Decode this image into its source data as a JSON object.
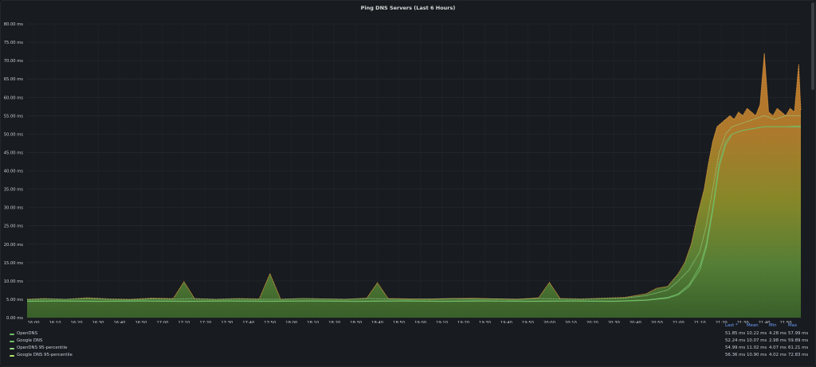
{
  "panel": {
    "title": "Ping DNS Servers (Last 6 Hours)"
  },
  "legend": {
    "headers": {
      "last": "Last *",
      "mean": "Mean",
      "min": "Min",
      "max": "Max"
    },
    "rows": [
      {
        "name": "OpenDNS",
        "color": "#73bf69",
        "last": "51.85 ms",
        "mean": "10.22 ms",
        "min": "4.28 ms",
        "max": "57.99 ms"
      },
      {
        "name": "Google DNS",
        "color": "#73bf69",
        "last": "52.24 ms",
        "mean": "10.07 ms",
        "min": "2.98 ms",
        "max": "59.89 ms"
      },
      {
        "name": "OpenDNS 95-percentile",
        "color": "#96d98d",
        "last": "54.99 ms",
        "mean": "11.02 ms",
        "min": "4.07 ms",
        "max": "61.21 ms"
      },
      {
        "name": "Google DNS 95-percentile",
        "color": "#b6e36b",
        "last": "56.36 ms",
        "mean": "10.90 ms",
        "min": "4.02 ms",
        "max": "72.83 ms"
      }
    ]
  },
  "chart_data": {
    "type": "line",
    "ylim": [
      0,
      80
    ],
    "yticks": [
      "0.00 ms",
      "5.00 ms",
      "10.00 ms",
      "15.00 ms",
      "20.00 ms",
      "25.00 ms",
      "30.00 ms",
      "35.00 ms",
      "40.00 ms",
      "45.00 ms",
      "50.00 ms",
      "55.00 ms",
      "60.00 ms",
      "65.00 ms",
      "70.00 ms",
      "75.00 ms",
      "80.00 ms"
    ],
    "xticks": [
      "16:00",
      "16:10",
      "16:20",
      "16:30",
      "16:40",
      "16:50",
      "17:00",
      "17:10",
      "17:20",
      "17:30",
      "17:40",
      "17:50",
      "18:00",
      "18:10",
      "18:20",
      "18:30",
      "18:40",
      "18:50",
      "19:00",
      "19:10",
      "19:20",
      "19:30",
      "19:40",
      "19:50",
      "20:00",
      "20:10",
      "20:20",
      "20:30",
      "20:40",
      "20:50",
      "21:00",
      "21:10",
      "21:20",
      "21:30",
      "21:40",
      "21:50"
    ],
    "x_start": "15:57",
    "x_end": "21:57",
    "series": [
      {
        "name": "Google DNS 95-percentile",
        "color": "#f2a341",
        "x": [
          "15:57",
          "16:05",
          "16:15",
          "16:25",
          "16:35",
          "16:45",
          "16:55",
          "17:05",
          "17:10",
          "17:15",
          "17:25",
          "17:35",
          "17:45",
          "17:50",
          "17:55",
          "18:05",
          "18:15",
          "18:25",
          "18:35",
          "18:40",
          "18:45",
          "18:55",
          "19:05",
          "19:15",
          "19:25",
          "19:35",
          "19:45",
          "19:55",
          "20:00",
          "20:05",
          "20:15",
          "20:25",
          "20:35",
          "20:45",
          "20:50",
          "20:55",
          "21:00",
          "21:03",
          "21:06",
          "21:09",
          "21:12",
          "21:14",
          "21:16",
          "21:18",
          "21:20",
          "21:22",
          "21:24",
          "21:26",
          "21:28",
          "21:30",
          "21:32",
          "21:34",
          "21:36",
          "21:38",
          "21:40",
          "21:42",
          "21:44",
          "21:46",
          "21:48",
          "21:50",
          "21:52",
          "21:54",
          "21:56",
          "21:57"
        ],
        "y": [
          5.0,
          5.2,
          5.0,
          5.4,
          5.1,
          5.0,
          5.3,
          5.2,
          9.8,
          5.1,
          5.0,
          5.2,
          5.1,
          12.0,
          5.0,
          5.2,
          5.1,
          5.0,
          5.3,
          9.5,
          5.2,
          5.1,
          5.0,
          5.2,
          5.3,
          5.1,
          5.0,
          5.4,
          9.6,
          5.2,
          5.1,
          5.3,
          5.5,
          6.5,
          8.0,
          8.5,
          12.0,
          15.0,
          20.0,
          28.0,
          35.0,
          42.0,
          48.0,
          52.0,
          53.0,
          54.0,
          55.0,
          54.0,
          56.0,
          55.0,
          57.0,
          56.0,
          55.0,
          58.0,
          72.0,
          56.0,
          55.0,
          57.0,
          56.0,
          55.0,
          57.0,
          56.0,
          69.0,
          56.4
        ]
      },
      {
        "name": "OpenDNS 95-percentile",
        "color": "#96d98d",
        "x": [
          "15:57",
          "16:05",
          "16:15",
          "16:25",
          "16:35",
          "16:45",
          "16:55",
          "17:05",
          "17:15",
          "17:25",
          "17:35",
          "17:45",
          "17:55",
          "18:05",
          "18:15",
          "18:25",
          "18:35",
          "18:45",
          "18:55",
          "19:05",
          "19:15",
          "19:25",
          "19:35",
          "19:45",
          "19:55",
          "20:05",
          "20:15",
          "20:25",
          "20:35",
          "20:45",
          "20:55",
          "21:00",
          "21:05",
          "21:10",
          "21:13",
          "21:16",
          "21:19",
          "21:22",
          "21:25",
          "21:30",
          "21:35",
          "21:40",
          "21:45",
          "21:50",
          "21:57"
        ],
        "y": [
          4.9,
          5.1,
          5.0,
          5.2,
          5.0,
          4.9,
          5.1,
          5.0,
          5.2,
          5.0,
          5.1,
          5.0,
          5.0,
          5.2,
          5.1,
          5.0,
          5.2,
          5.1,
          5.0,
          5.1,
          5.2,
          5.0,
          5.1,
          5.0,
          5.2,
          5.1,
          5.0,
          5.2,
          5.3,
          6.0,
          7.5,
          10.0,
          13.0,
          18.0,
          25.0,
          35.0,
          45.0,
          50.0,
          52.0,
          53.0,
          54.0,
          55.0,
          54.0,
          55.0,
          55.0
        ]
      },
      {
        "name": "OpenDNS",
        "color": "#73bf69",
        "x": [
          "15:57",
          "16:10",
          "16:30",
          "16:50",
          "17:10",
          "17:30",
          "17:50",
          "18:10",
          "18:30",
          "18:50",
          "19:10",
          "19:30",
          "19:50",
          "20:10",
          "20:30",
          "20:45",
          "20:55",
          "21:00",
          "21:05",
          "21:10",
          "21:13",
          "21:16",
          "21:19",
          "21:22",
          "21:25",
          "21:30",
          "21:40",
          "21:50",
          "21:57"
        ],
        "y": [
          4.5,
          4.6,
          4.5,
          4.6,
          4.5,
          4.6,
          4.5,
          4.6,
          4.5,
          4.6,
          4.5,
          4.6,
          4.5,
          4.6,
          4.5,
          4.8,
          5.5,
          6.5,
          9.0,
          14.0,
          20.0,
          30.0,
          42.0,
          48.0,
          50.0,
          51.0,
          52.0,
          52.0,
          51.85
        ]
      },
      {
        "name": "Google DNS",
        "color": "#73bf69",
        "x": [
          "15:57",
          "16:10",
          "16:30",
          "16:50",
          "17:10",
          "17:30",
          "17:50",
          "18:10",
          "18:30",
          "18:50",
          "19:10",
          "19:30",
          "19:50",
          "20:10",
          "20:30",
          "20:45",
          "20:55",
          "21:00",
          "21:05",
          "21:10",
          "21:13",
          "21:16",
          "21:19",
          "21:22",
          "21:25",
          "21:30",
          "21:40",
          "21:50",
          "21:57"
        ],
        "y": [
          4.4,
          4.5,
          4.4,
          4.5,
          4.4,
          4.5,
          4.4,
          4.5,
          4.4,
          4.5,
          4.4,
          4.5,
          4.4,
          4.5,
          4.4,
          4.7,
          5.3,
          6.2,
          8.5,
          13.0,
          19.0,
          29.0,
          41.0,
          47.0,
          50.0,
          51.0,
          52.0,
          52.0,
          52.24
        ]
      }
    ]
  }
}
